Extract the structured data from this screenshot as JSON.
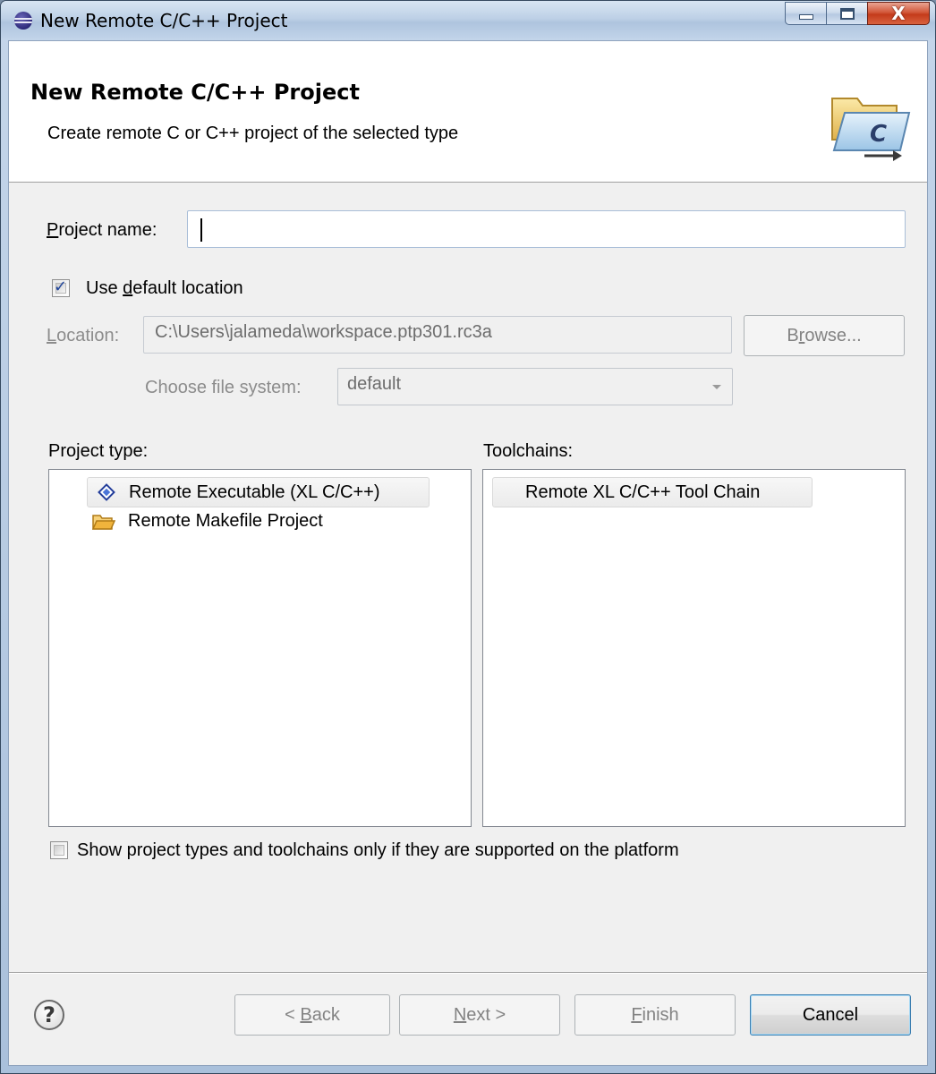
{
  "window": {
    "title": "New Remote C/C++ Project",
    "controls": {
      "close_glyph": "X"
    }
  },
  "header": {
    "title": "New Remote C/C++ Project",
    "subtitle": "Create remote C or C++ project of the selected type",
    "icon_letter": "C"
  },
  "form": {
    "project_name": {
      "label_mnemonic": "P",
      "label_rest": "roject name:",
      "value": ""
    },
    "use_default_location": {
      "label_before": "Use ",
      "label_mnemonic": "d",
      "label_after": "efault location",
      "checked": true
    },
    "location": {
      "label_mnemonic": "L",
      "label_rest": "ocation:",
      "value": "C:\\Users\\jalameda\\workspace.ptp301.rc3a"
    },
    "browse_button": {
      "label_before": "B",
      "label_mnemonic": "r",
      "label_after": "owse..."
    },
    "file_system": {
      "label": "Choose file system:",
      "selected": "default"
    }
  },
  "project_types": {
    "label": "Project type:",
    "items": [
      {
        "label": "Remote Executable (XL C/C++)",
        "icon": "diamond-icon",
        "selected": true
      },
      {
        "label": "Remote Makefile Project",
        "icon": "folder-icon",
        "selected": false
      }
    ]
  },
  "toolchains": {
    "label": "Toolchains:",
    "items": [
      {
        "label": "Remote XL C/C++ Tool Chain",
        "selected": true
      }
    ]
  },
  "supported_only": {
    "label": "Show project types and toolchains only if they are supported on the platform",
    "checked": false
  },
  "footer": {
    "help_glyph": "?",
    "back": {
      "prefix": "< ",
      "mnemonic": "B",
      "rest": "ack"
    },
    "next": {
      "mnemonic": "N",
      "rest": "ext >"
    },
    "finish": {
      "mnemonic": "F",
      "rest": "inish"
    },
    "cancel": "Cancel"
  },
  "colors": {
    "accent_selection": "#3c7fb1",
    "folder": "#f0b43c",
    "checkmark": "#21459a"
  }
}
